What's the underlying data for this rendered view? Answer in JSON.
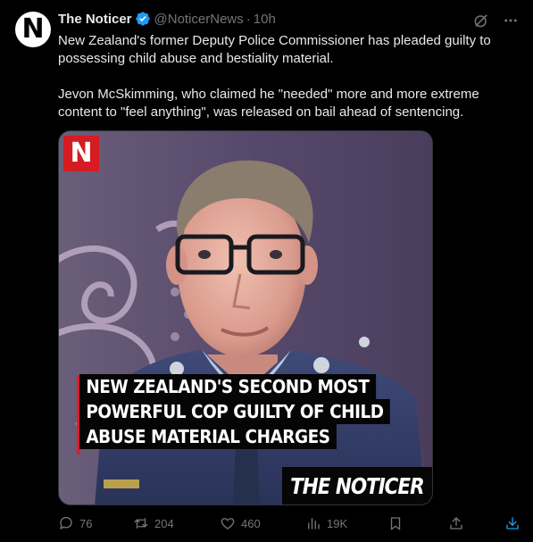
{
  "tweet": {
    "display_name": "The Noticer",
    "handle": "@NoticerNews",
    "separator": "·",
    "time": "10h",
    "avatar_letter": "N",
    "paragraphs": [
      "New Zealand's former Deputy Police Commissioner has pleaded guilty to possessing child abuse and bestiality material.",
      "Jevon McSkimming, who claimed he \"needed\" more and more extreme content to \"feel anything\", was released on bail ahead of sentencing."
    ]
  },
  "media": {
    "badge_letter": "N",
    "headline_lines": [
      "NEW ZEALAND'S SECOND MOST",
      "POWERFUL COP GUILTY OF CHILD",
      "ABUSE MATERIAL CHARGES"
    ],
    "brand_text": "THE NOTICER"
  },
  "actions": {
    "replies": "76",
    "reposts": "204",
    "likes": "460",
    "views": "19K"
  },
  "colors": {
    "background": "#000000",
    "text": "#e7e9ea",
    "muted": "#71767b",
    "verified": "#1d9bf0",
    "brand_red": "#d51c23"
  },
  "icons": [
    "verified-badge-icon",
    "grok-icon",
    "more-icon",
    "reply-icon",
    "repost-icon",
    "like-icon",
    "views-icon",
    "bookmark-icon",
    "share-icon",
    "download-icon"
  ]
}
